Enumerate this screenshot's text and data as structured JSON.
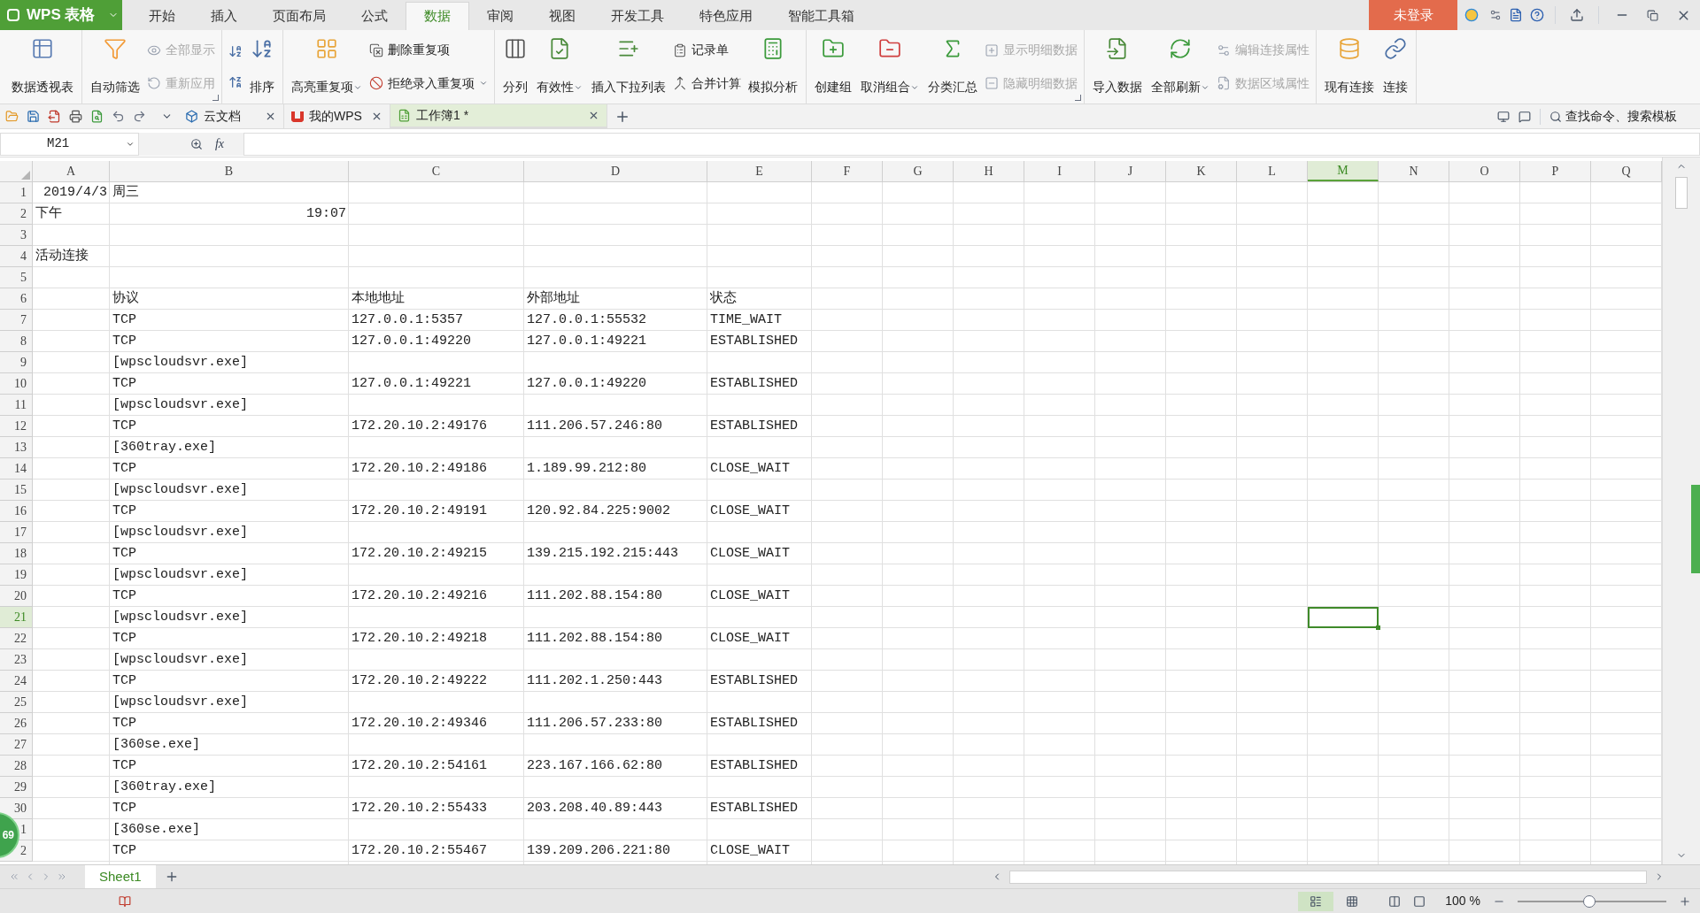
{
  "app_button": {
    "label": "WPS 表格"
  },
  "menu_tabs": [
    {
      "label": "开始",
      "selected": false
    },
    {
      "label": "插入",
      "selected": false
    },
    {
      "label": "页面布局",
      "selected": false
    },
    {
      "label": "公式",
      "selected": false
    },
    {
      "label": "数据",
      "selected": true
    },
    {
      "label": "审阅",
      "selected": false
    },
    {
      "label": "视图",
      "selected": false
    },
    {
      "label": "开发工具",
      "selected": false
    },
    {
      "label": "特色应用",
      "selected": false
    },
    {
      "label": "智能工具箱",
      "selected": false
    }
  ],
  "login_button": "未登录",
  "ribbon": [
    {
      "launcher": false,
      "items": [
        {
          "kind": "large",
          "label": "数据透视表",
          "dropdown": false
        }
      ]
    },
    {
      "launcher": true,
      "items": [
        {
          "kind": "large",
          "label": "自动筛选",
          "dropdown": false
        },
        {
          "kind": "stack",
          "items": [
            {
              "label": "全部显示",
              "disabled": true,
              "dropdown": false
            },
            {
              "label": "重新应用",
              "disabled": true,
              "dropdown": false
            }
          ]
        }
      ]
    },
    {
      "launcher": false,
      "items": [
        {
          "kind": "sort_icons"
        },
        {
          "kind": "large",
          "label": "排序",
          "dropdown": false
        }
      ]
    },
    {
      "launcher": false,
      "items": [
        {
          "kind": "large",
          "label": "高亮重复项",
          "dropdown": true
        },
        {
          "kind": "stack",
          "items": [
            {
              "label": "删除重复项",
              "disabled": false,
              "dropdown": false
            },
            {
              "label": "拒绝录入重复项",
              "disabled": false,
              "dropdown": true
            }
          ]
        }
      ]
    },
    {
      "launcher": false,
      "items": [
        {
          "kind": "large",
          "label": "分列",
          "dropdown": false
        },
        {
          "kind": "large",
          "label": "有效性",
          "dropdown": true
        },
        {
          "kind": "large",
          "label": "插入下拉列表",
          "dropdown": false
        },
        {
          "kind": "stack",
          "items": [
            {
              "label": "记录单",
              "disabled": false,
              "dropdown": false
            },
            {
              "label": "合并计算",
              "disabled": false,
              "dropdown": false
            }
          ]
        },
        {
          "kind": "large",
          "label": "模拟分析",
          "dropdown": false
        }
      ]
    },
    {
      "launcher": true,
      "items": [
        {
          "kind": "large",
          "label": "创建组",
          "dropdown": false
        },
        {
          "kind": "large",
          "label": "取消组合",
          "dropdown": true
        },
        {
          "kind": "large",
          "label": "分类汇总",
          "dropdown": false
        },
        {
          "kind": "stack",
          "items": [
            {
              "label": "显示明细数据",
              "disabled": true,
              "dropdown": false
            },
            {
              "label": "隐藏明细数据",
              "disabled": true,
              "dropdown": false
            }
          ]
        }
      ]
    },
    {
      "launcher": false,
      "items": [
        {
          "kind": "large",
          "label": "导入数据",
          "dropdown": false
        },
        {
          "kind": "large",
          "label": "全部刷新",
          "dropdown": true
        },
        {
          "kind": "stack",
          "items": [
            {
              "label": "编辑连接属性",
              "disabled": true,
              "dropdown": false
            },
            {
              "label": "数据区域属性",
              "disabled": true,
              "dropdown": false
            }
          ]
        }
      ]
    },
    {
      "launcher": false,
      "items": [
        {
          "kind": "large",
          "label": "现有连接",
          "dropdown": false
        },
        {
          "kind": "large",
          "label": "连接",
          "dropdown": false
        }
      ]
    }
  ],
  "doc_tabs": [
    {
      "label": "云文档",
      "selected": false
    },
    {
      "label": "我的WPS",
      "selected": false
    },
    {
      "label": "工作簿1 *",
      "selected": true
    }
  ],
  "search": {
    "placeholder": "查找命令、搜索模板"
  },
  "name_box": "M21",
  "formula_label": "fx",
  "columns": [
    {
      "label": "A",
      "selected": false
    },
    {
      "label": "B",
      "selected": false
    },
    {
      "label": "C",
      "selected": false
    },
    {
      "label": "D",
      "selected": false
    },
    {
      "label": "E",
      "selected": false
    },
    {
      "label": "F",
      "selected": false
    },
    {
      "label": "G",
      "selected": false
    },
    {
      "label": "H",
      "selected": false
    },
    {
      "label": "I",
      "selected": false
    },
    {
      "label": "J",
      "selected": false
    },
    {
      "label": "K",
      "selected": false
    },
    {
      "label": "L",
      "selected": false
    },
    {
      "label": "M",
      "selected": true
    },
    {
      "label": "N",
      "selected": false
    },
    {
      "label": "O",
      "selected": false
    },
    {
      "label": "P",
      "selected": false
    },
    {
      "label": "Q",
      "selected": false
    }
  ],
  "rows": [
    {
      "label": "1",
      "selected": false,
      "cells": {
        "a": {
          "text": "2019/4/3",
          "kind": "number"
        },
        "b": "周三"
      }
    },
    {
      "label": "2",
      "selected": false,
      "cells": {
        "a": "下午",
        "b": {
          "text": "19:07",
          "kind": "number"
        }
      }
    },
    {
      "label": "3",
      "selected": false,
      "cells": {}
    },
    {
      "label": "4",
      "selected": false,
      "cells": {
        "a": "活动连接"
      }
    },
    {
      "label": "5",
      "selected": false,
      "cells": {}
    },
    {
      "label": "6",
      "selected": false,
      "cells": {
        "b": "协议",
        "c": "本地地址",
        "d": "外部地址",
        "e": "状态"
      }
    },
    {
      "label": "7",
      "selected": false,
      "cells": {
        "b": "TCP",
        "c": "127.0.0.1:5357",
        "d": "127.0.0.1:55532",
        "e": "TIME_WAIT"
      }
    },
    {
      "label": "8",
      "selected": false,
      "cells": {
        "b": "TCP",
        "c": "127.0.0.1:49220",
        "d": "127.0.0.1:49221",
        "e": "ESTABLISHED"
      }
    },
    {
      "label": "9",
      "selected": false,
      "cells": {
        "b": "[wpscloudsvr.exe]"
      }
    },
    {
      "label": "10",
      "selected": false,
      "cells": {
        "b": "TCP",
        "c": "127.0.0.1:49221",
        "d": "127.0.0.1:49220",
        "e": "ESTABLISHED"
      }
    },
    {
      "label": "11",
      "selected": false,
      "cells": {
        "b": "[wpscloudsvr.exe]"
      }
    },
    {
      "label": "12",
      "selected": false,
      "cells": {
        "b": "TCP",
        "c": "172.20.10.2:49176",
        "d": "111.206.57.246:80",
        "e": "ESTABLISHED"
      }
    },
    {
      "label": "13",
      "selected": false,
      "cells": {
        "b": "[360tray.exe]"
      }
    },
    {
      "label": "14",
      "selected": false,
      "cells": {
        "b": "TCP",
        "c": "172.20.10.2:49186",
        "d": "1.189.99.212:80",
        "e": "CLOSE_WAIT"
      }
    },
    {
      "label": "15",
      "selected": false,
      "cells": {
        "b": "[wpscloudsvr.exe]"
      }
    },
    {
      "label": "16",
      "selected": false,
      "cells": {
        "b": "TCP",
        "c": "172.20.10.2:49191",
        "d": "120.92.84.225:9002",
        "e": "CLOSE_WAIT"
      }
    },
    {
      "label": "17",
      "selected": false,
      "cells": {
        "b": "[wpscloudsvr.exe]"
      }
    },
    {
      "label": "18",
      "selected": false,
      "cells": {
        "b": "TCP",
        "c": "172.20.10.2:49215",
        "d": "139.215.192.215:443",
        "e": "CLOSE_WAIT"
      }
    },
    {
      "label": "19",
      "selected": false,
      "cells": {
        "b": "[wpscloudsvr.exe]"
      }
    },
    {
      "label": "20",
      "selected": false,
      "cells": {
        "b": "TCP",
        "c": "172.20.10.2:49216",
        "d": "111.202.88.154:80",
        "e": "CLOSE_WAIT"
      }
    },
    {
      "label": "21",
      "selected": true,
      "cells": {
        "b": "[wpscloudsvr.exe]"
      }
    },
    {
      "label": "22",
      "selected": false,
      "cells": {
        "b": "TCP",
        "c": "172.20.10.2:49218",
        "d": "111.202.88.154:80",
        "e": "CLOSE_WAIT"
      }
    },
    {
      "label": "23",
      "selected": false,
      "cells": {
        "b": "[wpscloudsvr.exe]"
      }
    },
    {
      "label": "24",
      "selected": false,
      "cells": {
        "b": "TCP",
        "c": "172.20.10.2:49222",
        "d": "111.202.1.250:443",
        "e": "ESTABLISHED"
      }
    },
    {
      "label": "25",
      "selected": false,
      "cells": {
        "b": "[wpscloudsvr.exe]"
      }
    },
    {
      "label": "26",
      "selected": false,
      "cells": {
        "b": "TCP",
        "c": "172.20.10.2:49346",
        "d": "111.206.57.233:80",
        "e": "ESTABLISHED"
      }
    },
    {
      "label": "27",
      "selected": false,
      "cells": {
        "b": "[360se.exe]"
      }
    },
    {
      "label": "28",
      "selected": false,
      "cells": {
        "b": "TCP",
        "c": "172.20.10.2:54161",
        "d": "223.167.166.62:80",
        "e": "ESTABLISHED"
      }
    },
    {
      "label": "29",
      "selected": false,
      "cells": {
        "b": "[360tray.exe]"
      }
    },
    {
      "label": "30",
      "selected": false,
      "cells": {
        "b": "TCP",
        "c": "172.20.10.2:55433",
        "d": "203.208.40.89:443",
        "e": "ESTABLISHED"
      }
    },
    {
      "label": "1",
      "selected": false,
      "cells": {
        "b": "[360se.exe]"
      }
    },
    {
      "label": "2",
      "selected": false,
      "cells": {
        "b": "TCP",
        "c": "172.20.10.2:55467",
        "d": "139.209.206.221:80",
        "e": "CLOSE_WAIT"
      }
    }
  ],
  "floating_badge": {
    "text": "69"
  },
  "sheet_tabs": [
    {
      "label": "Sheet1",
      "selected": true
    }
  ],
  "zoom": {
    "reading": "100 %",
    "level": 0.48
  }
}
